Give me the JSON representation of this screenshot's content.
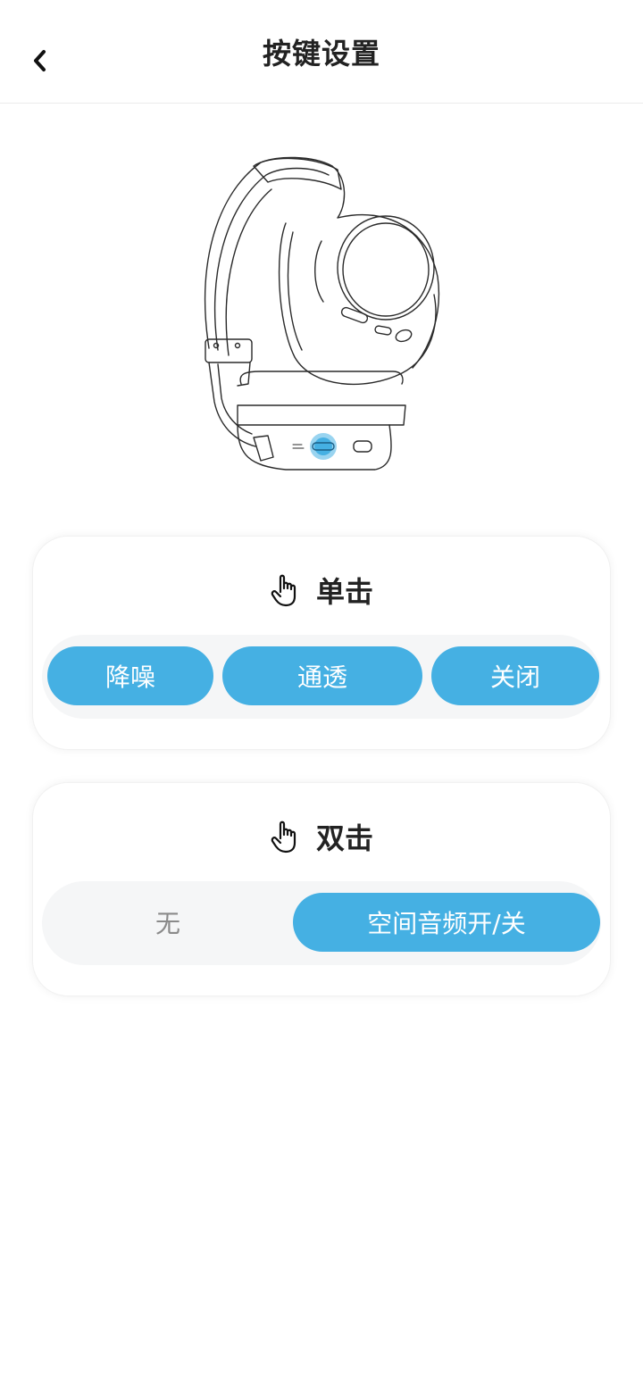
{
  "header": {
    "title": "按键设置",
    "back_icon": "chevron-left-icon"
  },
  "illustration": {
    "subject": "headphones-line-art",
    "highlight_color": "#45b0e3"
  },
  "single_tap": {
    "icon": "hand-pointer-icon",
    "title": "单击",
    "options": [
      {
        "label": "降噪",
        "selected": true
      },
      {
        "label": "通透",
        "selected": true
      },
      {
        "label": "关闭",
        "selected": true
      }
    ]
  },
  "double_tap": {
    "icon": "hand-pointer-icon",
    "title": "双击",
    "options": [
      {
        "label": "无",
        "selected": false
      },
      {
        "label": "空间音频开/关",
        "selected": true
      }
    ]
  },
  "colors": {
    "accent": "#45b0e3",
    "segment_bg": "#f5f6f7",
    "inactive_text": "#8a8a8a"
  }
}
